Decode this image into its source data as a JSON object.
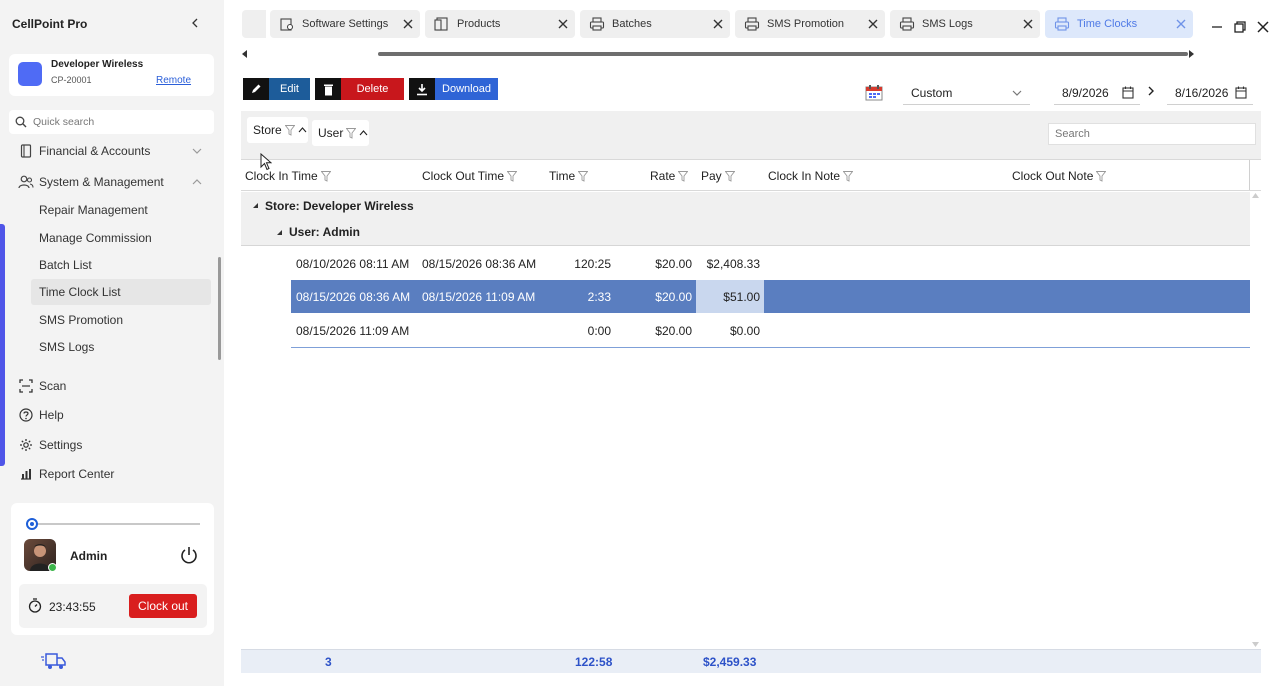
{
  "app": {
    "title": "CellPoint Pro"
  },
  "store": {
    "name": "Developer Wireless",
    "code": "CP-20001",
    "remote_label": "Remote"
  },
  "sidebar": {
    "search_placeholder": "Quick search",
    "sections": [
      {
        "label": "Financial & Accounts",
        "icon": "book-icon",
        "expanded": false
      },
      {
        "label": "System & Management",
        "icon": "users-icon",
        "expanded": true
      }
    ],
    "sub_items": [
      {
        "label": "Repair Management",
        "active": false
      },
      {
        "label": "Manage Commission",
        "active": false
      },
      {
        "label": "Batch List",
        "active": false
      },
      {
        "label": "Time Clock List",
        "active": true
      },
      {
        "label": "SMS Promotion",
        "active": false
      },
      {
        "label": "SMS Logs",
        "active": false
      }
    ],
    "bottom_items": [
      {
        "label": "Scan",
        "icon": "scan-icon"
      },
      {
        "label": "Help",
        "icon": "help-icon"
      },
      {
        "label": "Settings",
        "icon": "gear-icon"
      },
      {
        "label": "Report Center",
        "icon": "report-icon"
      }
    ]
  },
  "user": {
    "name": "Admin",
    "timer": "23:43:55",
    "clock_out_label": "Clock out"
  },
  "tabs": [
    {
      "label": "Software Settings",
      "icon": "settings-doc-icon",
      "active": false
    },
    {
      "label": "Products",
      "icon": "products-icon",
      "active": false
    },
    {
      "label": "Batches",
      "icon": "printer-icon",
      "active": false
    },
    {
      "label": "SMS Promotion",
      "icon": "printer-icon",
      "active": false
    },
    {
      "label": "SMS Logs",
      "icon": "printer-icon",
      "active": false
    },
    {
      "label": "Time Clocks",
      "icon": "printer-icon",
      "active": true
    }
  ],
  "toolbar": {
    "edit_label": "Edit",
    "delete_label": "Delete",
    "download_label": "Download",
    "range_value": "Custom",
    "date_from": "8/9/2026",
    "date_to": "8/16/2026"
  },
  "grid": {
    "group_chips": [
      "Store",
      "User"
    ],
    "search_placeholder": "Search",
    "columns": [
      "Clock In Time",
      "Clock Out Time",
      "Time",
      "Rate",
      "Pay",
      "Clock In Note",
      "Clock Out Note"
    ],
    "group_store": "Store: Developer Wireless",
    "group_user": "User: Admin",
    "rows": [
      {
        "clock_in": "08/10/2026 08:11 AM",
        "clock_out": "08/15/2026 08:36 AM",
        "time": "120:25",
        "rate": "$20.00",
        "pay": "$2,408.33",
        "selected": false
      },
      {
        "clock_in": "08/15/2026 08:36 AM",
        "clock_out": "08/15/2026 11:09 AM",
        "time": "2:33",
        "rate": "$20.00",
        "pay": "$51.00",
        "selected": true
      },
      {
        "clock_in": "08/15/2026 11:09 AM",
        "clock_out": "",
        "time": "0:00",
        "rate": "$20.00",
        "pay": "$0.00",
        "selected": false
      }
    ],
    "footer": {
      "count": "3",
      "total_time": "122:58",
      "total_pay": "$2,459.33"
    }
  },
  "colors": {
    "accent": "#4f55e8",
    "selected_row": "#5a7ec0",
    "delete": "#c8171c",
    "edit": "#1d5c9a",
    "download": "#2f64d6",
    "footer_text": "#2d52c8"
  }
}
